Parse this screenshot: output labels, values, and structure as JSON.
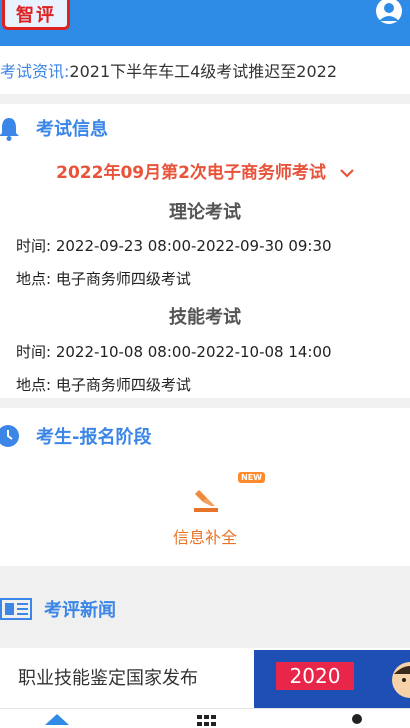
{
  "header": {
    "logo_text": "智评"
  },
  "ticker": {
    "label": "考试资讯:",
    "text": " 2021下半年车工4级考试推迟至2022"
  },
  "exam_info": {
    "title": "考试信息",
    "selected_exam": "2022年09月第2次电子商务师考试",
    "theory": {
      "title": "理论考试",
      "time": "时间: 2022-09-23 08:00-2022-09-30 09:30",
      "place": "地点: 电子商务师四级考试"
    },
    "skill": {
      "title": "技能考试",
      "time": "时间: 2022-10-08 08:00-2022-10-08 14:00",
      "place": "地点: 电子商务师四级考试"
    }
  },
  "registration": {
    "title": "考生-报名阶段",
    "badge": "NEW",
    "item_label": "信息补全"
  },
  "news": {
    "title": "考评新闻",
    "headline": "职业技能鉴定国家发布",
    "banner_year": "2020"
  },
  "colors": {
    "primary": "#2f8ce6",
    "accent": "#e8533a",
    "orange": "#e8742a"
  }
}
